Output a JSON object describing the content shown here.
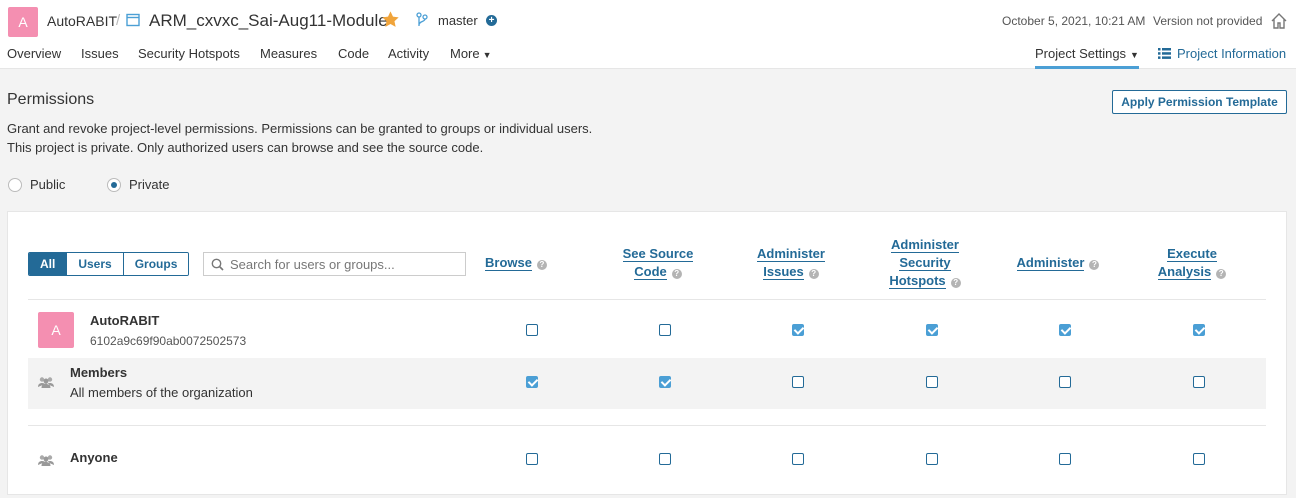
{
  "header": {
    "org_avatar_letter": "A",
    "org_name": "AutoRABIT",
    "separator": "/",
    "project_name": "ARM_cxvxc_Sai-Aug11-Module",
    "branch": "master",
    "date": "October 5, 2021, 10:21 AM",
    "version": "Version not provided",
    "accent": "#236a97",
    "star_color": "#f0a43b"
  },
  "nav": {
    "items": [
      "Overview",
      "Issues",
      "Security Hotspots",
      "Measures",
      "Code",
      "Activity",
      "More"
    ],
    "project_settings": "Project Settings",
    "project_information": "Project Information"
  },
  "page": {
    "title": "Permissions",
    "apply_template": "Apply Permission Template",
    "desc1": "Grant and revoke project-level permissions. Permissions can be granted to groups or individual users.",
    "desc2": "This project is private. Only authorized users can browse and see the source code.",
    "visibility": {
      "public": "Public",
      "private": "Private",
      "selected": "Private"
    }
  },
  "filter": {
    "all": "All",
    "users": "Users",
    "groups": "Groups",
    "selected": "All",
    "search_placeholder": "Search for users or groups..."
  },
  "columns": [
    [
      "Browse"
    ],
    [
      "See Source",
      "Code"
    ],
    [
      "Administer",
      "Issues"
    ],
    [
      "Administer",
      "Security",
      "Hotspots"
    ],
    [
      "Administer"
    ],
    [
      "Execute",
      "Analysis"
    ]
  ],
  "rows": [
    {
      "type": "user",
      "avatar": "A",
      "name": "AutoRABIT",
      "sub": "6102a9c69f90ab0072502573",
      "perms": [
        false,
        false,
        true,
        true,
        true,
        true
      ]
    },
    {
      "type": "group",
      "name": "Members",
      "desc": "All members of the organization",
      "perms": [
        true,
        true,
        false,
        false,
        false,
        false
      ]
    },
    {
      "type": "group",
      "name": "Anyone",
      "perms": [
        false,
        false,
        false,
        false,
        false,
        false
      ]
    }
  ]
}
